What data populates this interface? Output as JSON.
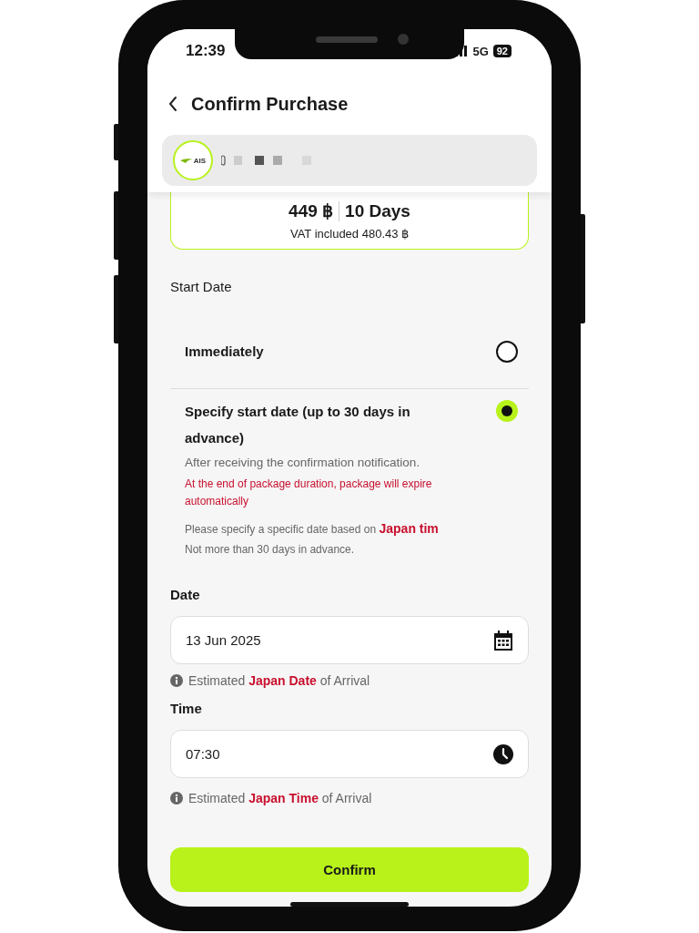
{
  "status_bar": {
    "time": "12:39",
    "network": "5G",
    "battery": "92"
  },
  "header": {
    "title": "Confirm Purchase"
  },
  "account": {
    "logo": "AIS"
  },
  "package": {
    "price": "449 ฿",
    "duration": "10 Days",
    "vat": "VAT included 480.43 ฿"
  },
  "start_date": {
    "label": "Start Date",
    "options": [
      {
        "title": "Immediately",
        "selected": false
      },
      {
        "title": "Specify start date (up to 30 days in advance)",
        "selected": true,
        "notes": [
          {
            "kind": "info",
            "text": "After receiving the confirmation notification."
          },
          {
            "kind": "warning",
            "text": "At the end of package duration, package will expire automatically"
          },
          {
            "kind": "small",
            "text": "Please specify a specific date based on **Japan tim**"
          },
          {
            "kind": "small",
            "text": "Not more than 30 days in advance."
          }
        ]
      }
    ]
  },
  "fields": [
    {
      "kind": "date",
      "label": "Date",
      "value": "13 Jun 2025",
      "hint": "Estimated **Japan Date** of Arrival"
    },
    {
      "kind": "time",
      "label": "Time",
      "value": "07:30",
      "hint": "Estimated **Japan Time** of Arrival"
    }
  ],
  "confirm_button": "Confirm"
}
